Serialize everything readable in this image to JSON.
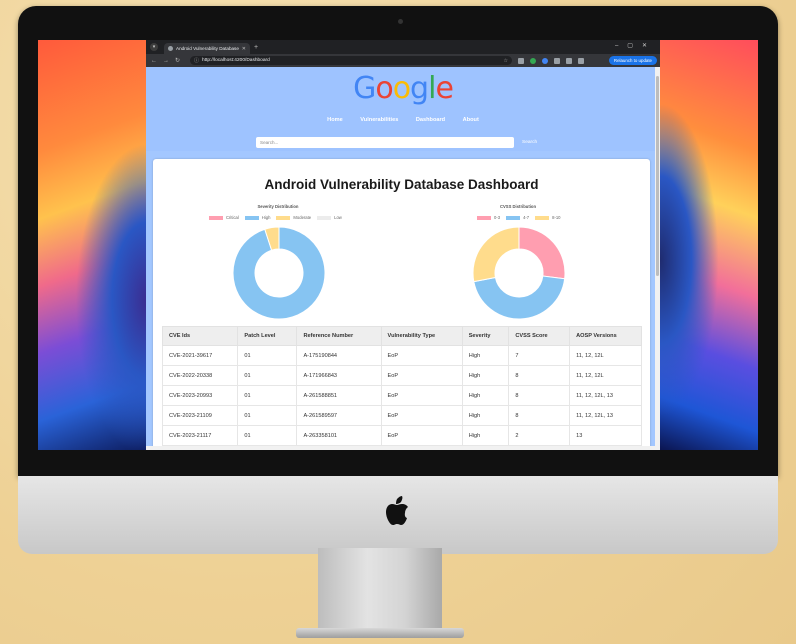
{
  "browser": {
    "tab_title": "Android Vulnerability Database",
    "url": "http://localhost:4200/Dashboard",
    "relaunch_label": "Relaunch to update"
  },
  "header": {
    "logo_letters": [
      "G",
      "o",
      "o",
      "g",
      "l",
      "e"
    ],
    "nav": [
      "Home",
      "Vulnerabilities",
      "Dashboard",
      "About"
    ],
    "search_placeholder": "Search...",
    "search_button": "Search"
  },
  "dashboard": {
    "title": "Android Vulnerability Database Dashboard"
  },
  "chart_data": [
    {
      "type": "pie",
      "title": "Severity Distribution",
      "labels": [
        "Critical",
        "High",
        "Moderate",
        "Low"
      ],
      "colors": [
        "#ff9eb0",
        "#86c4f2",
        "#ffdc8c",
        "#ececec"
      ],
      "values": [
        0,
        95,
        5,
        0
      ]
    },
    {
      "type": "pie",
      "title": "CVSS Distribution",
      "labels": [
        "0-3",
        "4-7",
        "8-10"
      ],
      "colors": [
        "#ff9eb0",
        "#86c4f2",
        "#ffdc8c"
      ],
      "values": [
        27,
        45,
        28
      ]
    }
  ],
  "table": {
    "headers": [
      "CVE Ids",
      "Patch Level",
      "Reference Number",
      "Vulnerability Type",
      "Severity",
      "CVSS Score",
      "AOSP Versions"
    ],
    "rows": [
      [
        "CVE-2021-39617",
        "01",
        "A-175190844",
        "EoP",
        "High",
        "7",
        "11, 12, 12L"
      ],
      [
        "CVE-2022-20338",
        "01",
        "A-171966843",
        "EoP",
        "High",
        "8",
        "11, 12, 12L"
      ],
      [
        "CVE-2023-20993",
        "01",
        "A-261588851",
        "EoP",
        "High",
        "8",
        "11, 12, 12L, 13"
      ],
      [
        "CVE-2023-21109",
        "01",
        "A-261589597",
        "EoP",
        "High",
        "8",
        "11, 12, 12L, 13"
      ],
      [
        "CVE-2023-21117",
        "01",
        "A-263358101",
        "EoP",
        "High",
        "2",
        "13"
      ]
    ]
  }
}
